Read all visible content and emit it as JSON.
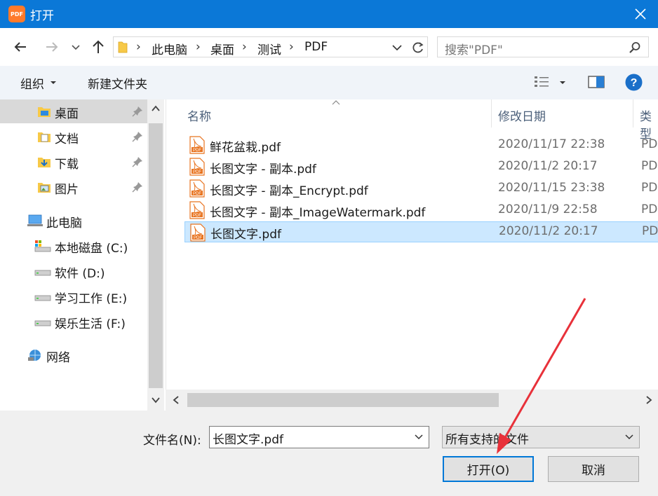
{
  "window": {
    "title": "打开",
    "app_icon_text": "PDF"
  },
  "navigation": {
    "breadcrumbs": [
      "此电脑",
      "桌面",
      "测试",
      "PDF"
    ],
    "search_placeholder": "搜索\"PDF\""
  },
  "toolbar": {
    "organize_label": "组织",
    "new_folder_label": "新建文件夹"
  },
  "sidebar": {
    "quick_access": [
      {
        "label": "桌面",
        "icon": "desktop-folder-icon",
        "selected": true
      },
      {
        "label": "文档",
        "icon": "documents-folder-icon"
      },
      {
        "label": "下载",
        "icon": "downloads-folder-icon"
      },
      {
        "label": "图片",
        "icon": "pictures-folder-icon"
      }
    ],
    "this_pc": "此电脑",
    "drives": [
      {
        "label": "本地磁盘 (C:)",
        "icon": "system-drive-icon"
      },
      {
        "label": "软件 (D:)",
        "icon": "drive-icon"
      },
      {
        "label": "学习工作 (E:)",
        "icon": "drive-icon"
      },
      {
        "label": "娱乐生活 (F:)",
        "icon": "drive-icon"
      }
    ],
    "network": "网络"
  },
  "file_list": {
    "columns": {
      "name": "名称",
      "modified": "修改日期",
      "type": "类型"
    },
    "files": [
      {
        "name": "鲜花盆栽.pdf",
        "modified": "2020/11/17 22:38",
        "type": "PD"
      },
      {
        "name": "长图文字 - 副本.pdf",
        "modified": "2020/11/2 20:17",
        "type": "PD"
      },
      {
        "name": "长图文字 - 副本_Encrypt.pdf",
        "modified": "2020/11/15 23:38",
        "type": "PD"
      },
      {
        "name": "长图文字 - 副本_ImageWatermark.pdf",
        "modified": "2020/11/9 22:58",
        "type": "PD"
      },
      {
        "name": "长图文字.pdf",
        "modified": "2020/11/2 20:17",
        "type": "PD",
        "selected": true
      }
    ]
  },
  "footer": {
    "filename_label": "文件名(N):",
    "filename_value": "长图文字.pdf",
    "filter_value": "所有支持的文件",
    "open_button": "打开(O)",
    "cancel_button": "取消"
  },
  "colors": {
    "titlebar": "#0b78d7",
    "selection": "#cce8ff",
    "accent": "#0078d7",
    "annotation_arrow": "#e8313a"
  }
}
